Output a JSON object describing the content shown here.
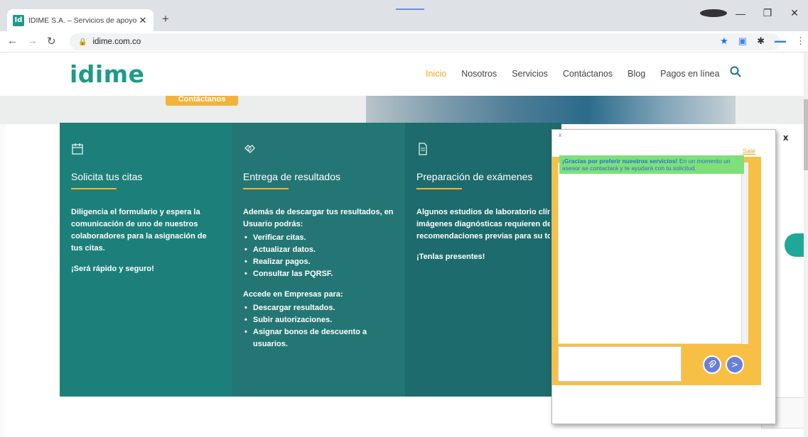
{
  "browser": {
    "tab_title": "IDIME S.A. – Servicios de apoyo a",
    "favicon_text": "Id",
    "tab_close": "✕",
    "new_tab": "+",
    "url": "idime.com.co",
    "win_minimize": "—",
    "win_restore": "❐",
    "win_close": "✕"
  },
  "site": {
    "logo": "idime",
    "nav": [
      "Inicio",
      "Nosotros",
      "Servicios",
      "Contáctanos",
      "Blog",
      "Pagos en línea"
    ],
    "contact_button": "Contáctanos"
  },
  "cards": [
    {
      "title": "Solicita tus citas",
      "paragraphs": [
        "Diligencia el formulario y espera la comunicación de uno de nuestros colaboradores para la asignación de tus citas.",
        "¡Será rápido y seguro!"
      ]
    },
    {
      "title": "Entrega de resultados",
      "intro": "Además de descargar tus resultados, en Usuario podrás:",
      "list1": [
        "Verificar citas.",
        "Actualizar datos.",
        "Realizar pagos.",
        "Consultar las PQRSF."
      ],
      "intro2": "Accede en Empresas para:",
      "list2": [
        "Descargar resultados.",
        "Subir autorizaciones.",
        "Asignar bonos de descuento a usuarios."
      ]
    },
    {
      "title": "Preparación de exámenes",
      "lines": [
        "Algunos estudios de laboratorio clíni",
        "imágenes diagnósticas requieren de",
        "recomendaciones previas para su to"
      ],
      "closing": "¡Tenlas presentes!"
    }
  ],
  "chat": {
    "close": "x",
    "sale": "Sale",
    "message_bold": "¡Gracias por preferir nuestros servicios!",
    "message_rest": " En un momento un asesor se contactará y te ayudará con tu solicitud.",
    "send": ">",
    "float_close": "x"
  },
  "colors": {
    "brand": "#1f9a8a",
    "accent": "#f4b23c",
    "card1": "#1d7f7a",
    "card2": "#247674",
    "card3": "#1d6b6c",
    "chat_frame": "#f7c044",
    "chat_message": "#7fe07a"
  },
  "icons": [
    "calendar-icon",
    "handshake-icon",
    "document-icon",
    "search-icon",
    "lock-icon",
    "star-icon",
    "extensions-icon",
    "attach-icon",
    "send-icon",
    "whatsapp-icon"
  ]
}
